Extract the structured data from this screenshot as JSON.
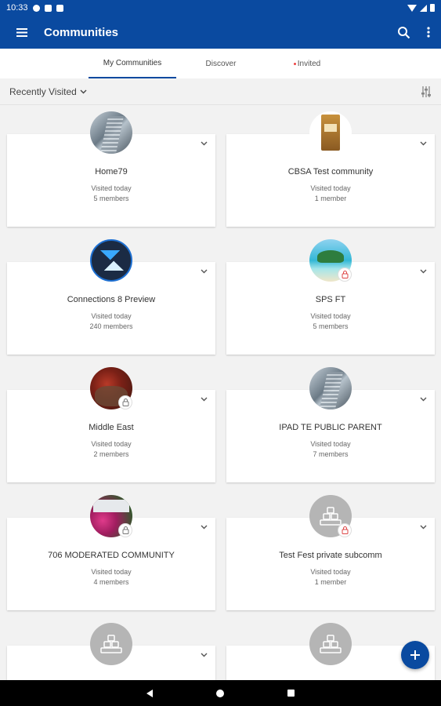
{
  "status_bar": {
    "time": "10:33"
  },
  "app_bar": {
    "title": "Communities"
  },
  "tabs": [
    {
      "label": "My Communities"
    },
    {
      "label": "Discover"
    },
    {
      "label": "Invited"
    }
  ],
  "filter": {
    "sort_label": "Recently Visited"
  },
  "communities": [
    {
      "name": "Home79",
      "visited": "Visited today",
      "members": "5 members"
    },
    {
      "name": "CBSA Test community",
      "visited": "Visited today",
      "members": "1 member"
    },
    {
      "name": "Connections 8 Preview",
      "visited": "Visited today",
      "members": "240 members"
    },
    {
      "name": "SPS FT",
      "visited": "Visited today",
      "members": "5 members"
    },
    {
      "name": "Middle East",
      "visited": "Visited today",
      "members": "2 members"
    },
    {
      "name": "IPAD TE PUBLIC PARENT",
      "visited": "Visited today",
      "members": "7 members"
    },
    {
      "name": "706 MODERATED COMMUNITY",
      "visited": "Visited today",
      "members": "4 members"
    },
    {
      "name": "Test Fest private subcomm",
      "visited": "Visited today",
      "members": "1 member"
    }
  ],
  "colors": {
    "primary": "#0a4aa0",
    "background": "#f2f2f2"
  }
}
